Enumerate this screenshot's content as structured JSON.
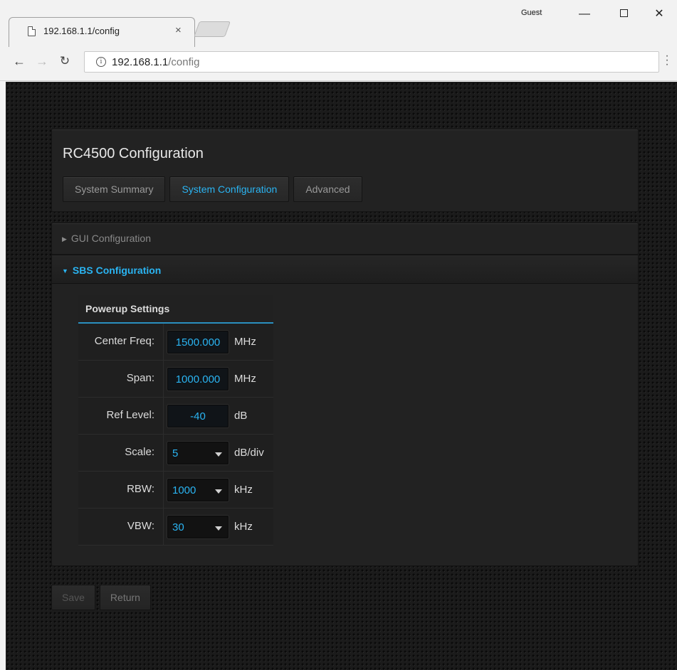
{
  "browser": {
    "tab_title": "192.168.1.1/config",
    "tab_close": "×",
    "profile": "Guest",
    "url_host": "192.168.1.1",
    "url_path": "/config",
    "win_min": "—",
    "win_close": "✕"
  },
  "page": {
    "title": "RC4500 Configuration",
    "tabs": [
      {
        "label": "System Summary",
        "active": false
      },
      {
        "label": "System Configuration",
        "active": true
      },
      {
        "label": "Advanced",
        "active": false
      }
    ]
  },
  "sections": {
    "gui": {
      "label": "GUI Configuration",
      "expanded": false
    },
    "sbs": {
      "label": "SBS Configuration",
      "expanded": true
    }
  },
  "powerup": {
    "heading": "Powerup Settings",
    "rows": [
      {
        "label": "Center Freq:",
        "type": "input",
        "value": "1500.000",
        "unit": "MHz"
      },
      {
        "label": "Span:",
        "type": "input",
        "value": "1000.000",
        "unit": "MHz"
      },
      {
        "label": "Ref Level:",
        "type": "input",
        "value": "-40",
        "unit": "dB"
      },
      {
        "label": "Scale:",
        "type": "select",
        "value": "5",
        "unit": "dB/div"
      },
      {
        "label": "RBW:",
        "type": "select",
        "value": "1000",
        "unit": "kHz"
      },
      {
        "label": "VBW:",
        "type": "select",
        "value": "30",
        "unit": "kHz"
      }
    ]
  },
  "footer": {
    "save_label": "Save",
    "return_label": "Return"
  },
  "colors": {
    "accent": "#2ab4f2",
    "background": "#1b1b1b",
    "panel": "#222222"
  }
}
